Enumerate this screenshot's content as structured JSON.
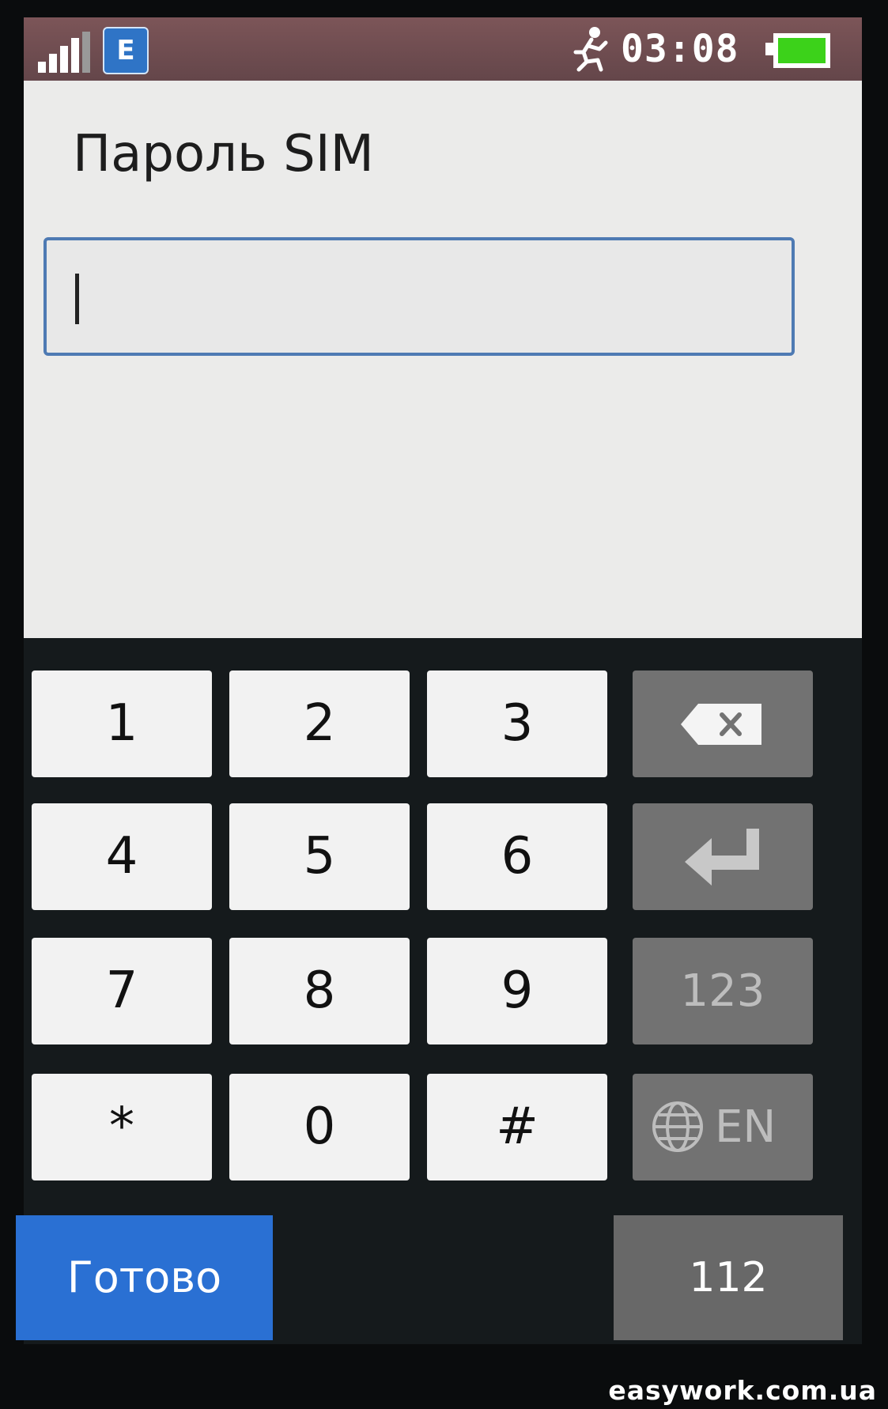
{
  "status_bar": {
    "network_type": "E",
    "time": "03:08",
    "icons": [
      "signal-icon",
      "edge-network-icon",
      "running-man-icon",
      "battery-icon"
    ]
  },
  "title": "Пароль SIM",
  "pin_input": {
    "value": ""
  },
  "keypad": {
    "keys": [
      "1",
      "2",
      "3",
      "4",
      "5",
      "6",
      "7",
      "8",
      "9",
      "*",
      "0",
      "#"
    ],
    "mode_key": "123",
    "language_key": "EN",
    "function_icons": [
      "backspace-icon",
      "enter-icon",
      "globe-icon"
    ]
  },
  "buttons": {
    "done": "Готово",
    "emergency": "112"
  },
  "watermark": "easywork.com.ua",
  "colors": {
    "status_bar": "#6e4c50",
    "content_bg": "#ebebea",
    "field_border": "#4e7ab3",
    "done_button": "#2a70d3",
    "function_key": "#727272",
    "battery_fill": "#3cd21a"
  }
}
